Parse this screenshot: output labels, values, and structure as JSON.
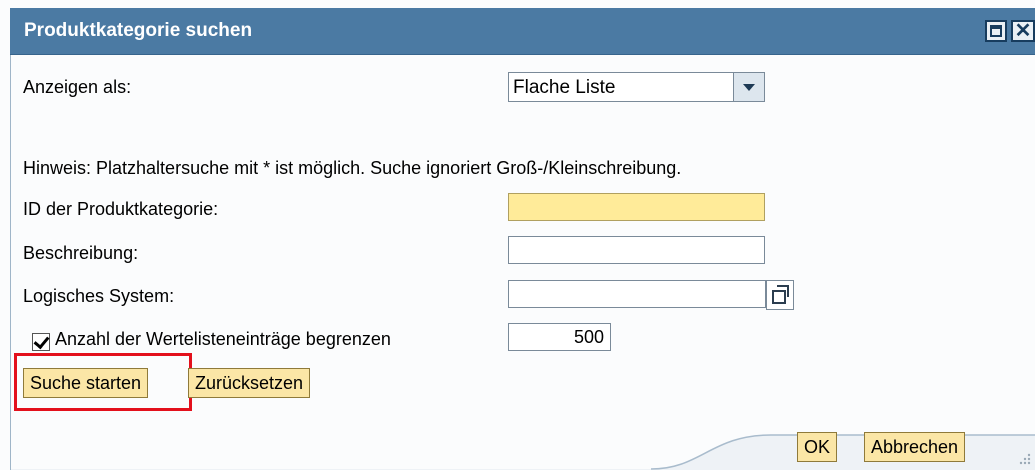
{
  "dialog": {
    "title": "Produktkategorie suchen"
  },
  "form": {
    "display_as_label": "Anzeigen als:",
    "display_as_value": "Flache Liste",
    "hint": "Hinweis: Platzhaltersuche mit * ist möglich. Suche ignoriert Groß-/Kleinschreibung.",
    "category_id_label": "ID der Produktkategorie:",
    "category_id_value": "",
    "description_label": "Beschreibung:",
    "description_value": "",
    "logical_system_label": "Logisches System:",
    "logical_system_value": "",
    "limit_label": "Anzahl der Wertelisteneinträge begrenzen",
    "limit_checked": true,
    "limit_value": "500"
  },
  "buttons": {
    "start_search": "Suche starten",
    "reset": "Zurücksetzen",
    "ok": "OK",
    "cancel": "Abbrechen"
  },
  "colors": {
    "titlebar": "#4b7aa3",
    "button": "#fbe6a6",
    "highlight": "#e3101c",
    "focused_input": "#ffeb99"
  }
}
